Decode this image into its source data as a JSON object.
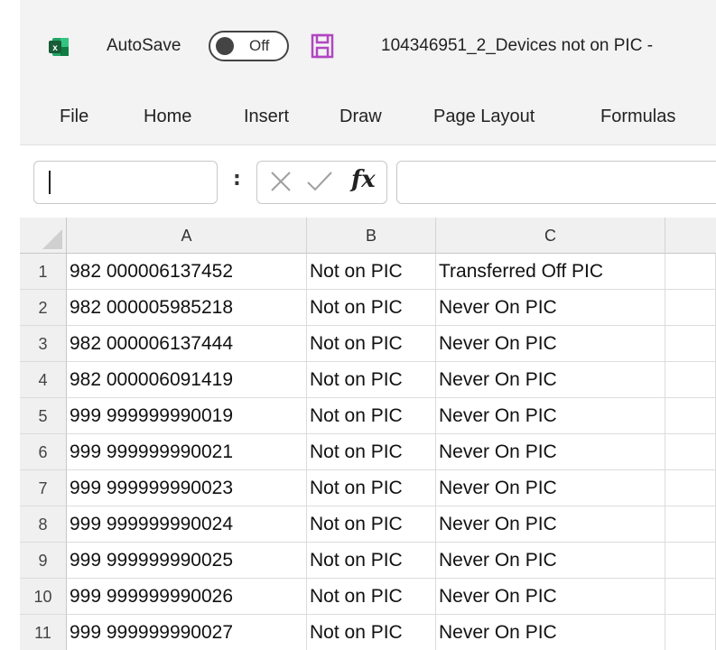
{
  "titlebar": {
    "autosave_label": "AutoSave",
    "autosave_state": "Off",
    "document_title": "104346951_2_Devices not on PIC -"
  },
  "ribbon": {
    "tabs": [
      "File",
      "Home",
      "Insert",
      "Draw",
      "Page Layout",
      "Formulas"
    ]
  },
  "formula_bar": {
    "name_box_value": "",
    "fx_label": "fx",
    "formula_value": ""
  },
  "columns": [
    "A",
    "B",
    "C"
  ],
  "rows": [
    {
      "num": "1",
      "a": "982 000006137452",
      "b": "Not on PIC",
      "c": "Transferred Off PIC"
    },
    {
      "num": "2",
      "a": "982 000005985218",
      "b": "Not on PIC",
      "c": "Never On PIC"
    },
    {
      "num": "3",
      "a": "982 000006137444",
      "b": "Not on PIC",
      "c": "Never On PIC"
    },
    {
      "num": "4",
      "a": "982 000006091419",
      "b": "Not on PIC",
      "c": "Never On PIC"
    },
    {
      "num": "5",
      "a": "999 999999990019",
      "b": "Not on PIC",
      "c": "Never On PIC"
    },
    {
      "num": "6",
      "a": "999 999999990021",
      "b": "Not on PIC",
      "c": "Never On PIC"
    },
    {
      "num": "7",
      "a": "999 999999990023",
      "b": "Not on PIC",
      "c": "Never On PIC"
    },
    {
      "num": "8",
      "a": "999 999999990024",
      "b": "Not on PIC",
      "c": "Never On PIC"
    },
    {
      "num": "9",
      "a": "999 999999990025",
      "b": "Not on PIC",
      "c": "Never On PIC"
    },
    {
      "num": "10",
      "a": "999 999999990026",
      "b": "Not on PIC",
      "c": "Never On PIC"
    },
    {
      "num": "11",
      "a": "999 999999990027",
      "b": "Not on PIC",
      "c": "Never On PIC"
    }
  ],
  "colors": {
    "excel_green": "#1d6f42",
    "save_purple": "#b146c2"
  }
}
